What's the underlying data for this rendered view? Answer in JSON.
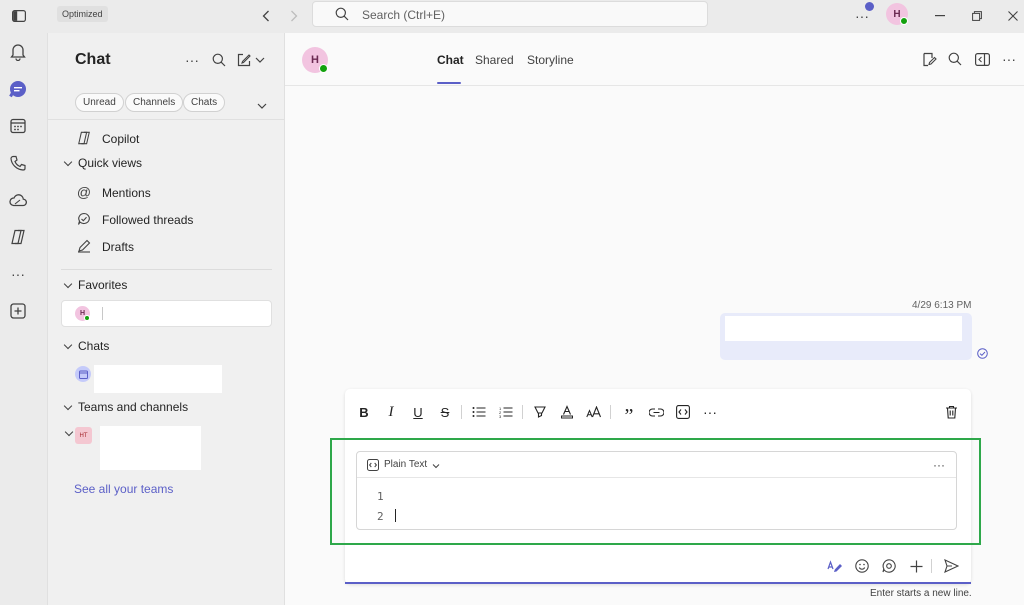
{
  "titlebar": {
    "badge": "Optimized",
    "search_placeholder": "Search (Ctrl+E)",
    "user_initial": "H"
  },
  "sidebar": {
    "title": "Chat",
    "filters": [
      "Unread",
      "Channels",
      "Chats"
    ],
    "copilot": "Copilot",
    "quick_views_header": "Quick views",
    "quick_views": [
      "Mentions",
      "Followed threads",
      "Drafts"
    ],
    "favorites_header": "Favorites",
    "favorite_initial": "H",
    "chats_header": "Chats",
    "teams_header": "Teams and channels",
    "team_initials": "HT",
    "see_all_teams": "See all your teams"
  },
  "chat": {
    "contact_initial": "H",
    "tabs": [
      "Chat",
      "Shared",
      "Storyline"
    ],
    "message_time": "4/29 6:13 PM"
  },
  "compose": {
    "code_language": "Plain Text",
    "line_numbers": [
      "1",
      "2"
    ],
    "hint": "Enter starts a new line."
  },
  "colors": {
    "accent": "#5b5fc7",
    "highlight_box": "#2ea84a",
    "presence": "#13a10e"
  }
}
